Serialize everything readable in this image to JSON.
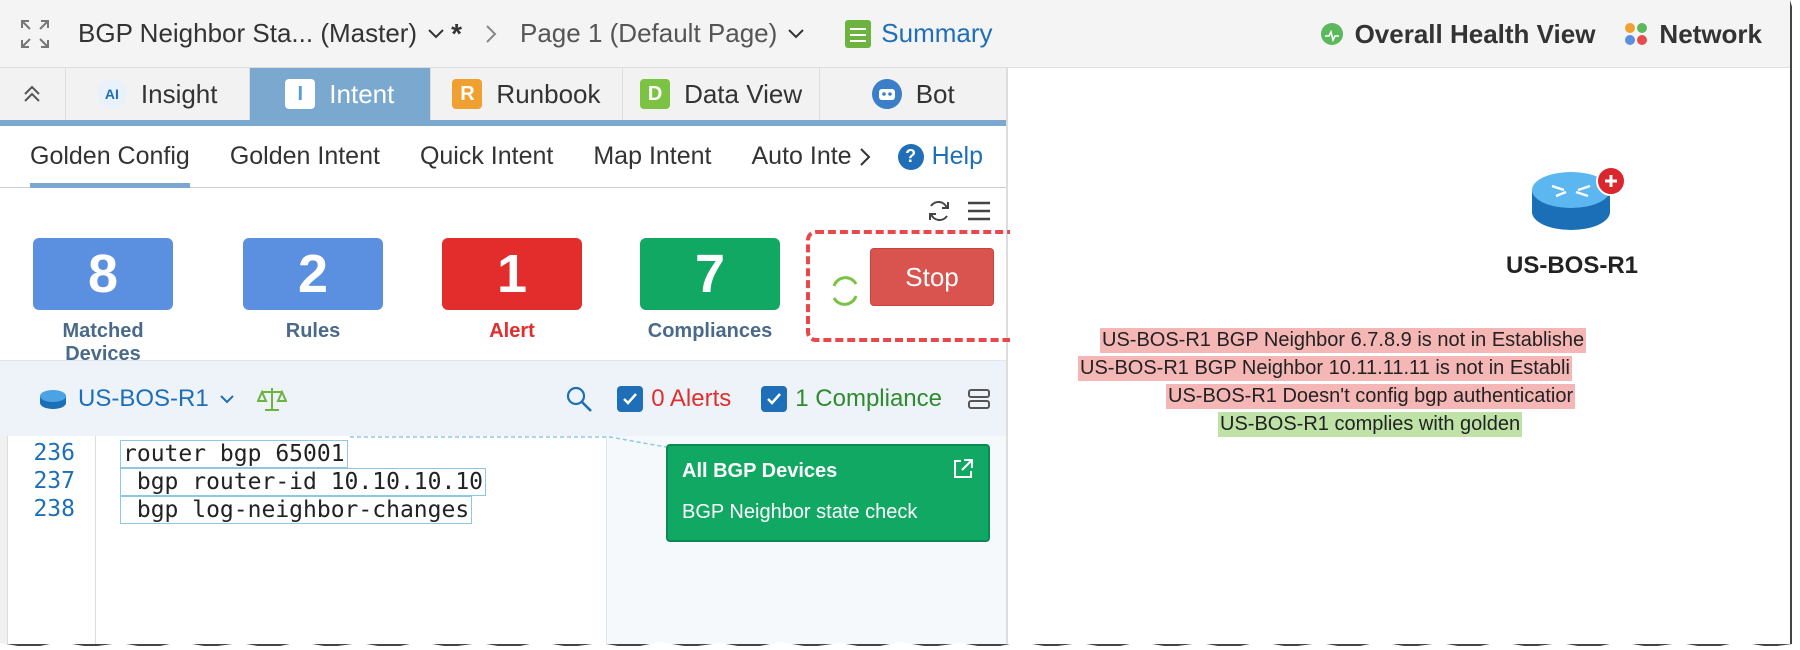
{
  "topbar": {
    "title": "BGP Neighbor Sta... (Master)",
    "dirty_mark": "*",
    "page": "Page 1  (Default Page)",
    "summary": "Summary",
    "health": "Overall Health View",
    "network": "Network"
  },
  "tabs": [
    {
      "label": "Insight",
      "icon": "ai-insight-icon"
    },
    {
      "label": "Intent",
      "icon": "intent-icon",
      "letter": "I",
      "active": true
    },
    {
      "label": "Runbook",
      "icon": "runbook-icon",
      "letter": "R"
    },
    {
      "label": "Data View",
      "icon": "data-view-icon",
      "letter": "D"
    },
    {
      "label": "Bot",
      "icon": "bot-icon"
    }
  ],
  "subtabs": [
    "Golden Config",
    "Golden Intent",
    "Quick Intent",
    "Map Intent",
    "Auto Inte"
  ],
  "help_label": "Help",
  "stats": [
    {
      "value": "8",
      "label": "Matched Devices",
      "color": "#5b8fdf"
    },
    {
      "value": "2",
      "label": "Rules",
      "color": "#5b8fdf"
    },
    {
      "value": "1",
      "label": "Alert",
      "color": "#e32d2d"
    },
    {
      "value": "7",
      "label": "Compliances",
      "color": "#11a863"
    }
  ],
  "stop_label": "Stop",
  "device_bar": {
    "device": "US-BOS-R1",
    "alerts": "0 Alerts",
    "compliance": "1 Compliance"
  },
  "code": {
    "lines": [
      {
        "num": "236",
        "text": "router bgp 65001"
      },
      {
        "num": "237",
        "text": " bgp router-id 10.10.10.10"
      },
      {
        "num": "238",
        "text": " bgp log-neighbor-changes"
      }
    ]
  },
  "intent_card": {
    "title": "All BGP Devices",
    "subtitle": "BGP Neighbor state check"
  },
  "map": {
    "device": "US-BOS-R1",
    "notes": [
      {
        "text": "US-BOS-R1 BGP Neighbor 6.7.8.9  is not in Establishe",
        "status": "bad"
      },
      {
        "text": "US-BOS-R1 BGP Neighbor 10.11.11.11  is not in Establi",
        "status": "bad"
      },
      {
        "text": "US-BOS-R1 Doesn't config bgp authenticatior",
        "status": "bad"
      },
      {
        "text": "US-BOS-R1  complies with golden",
        "status": "good"
      }
    ]
  }
}
